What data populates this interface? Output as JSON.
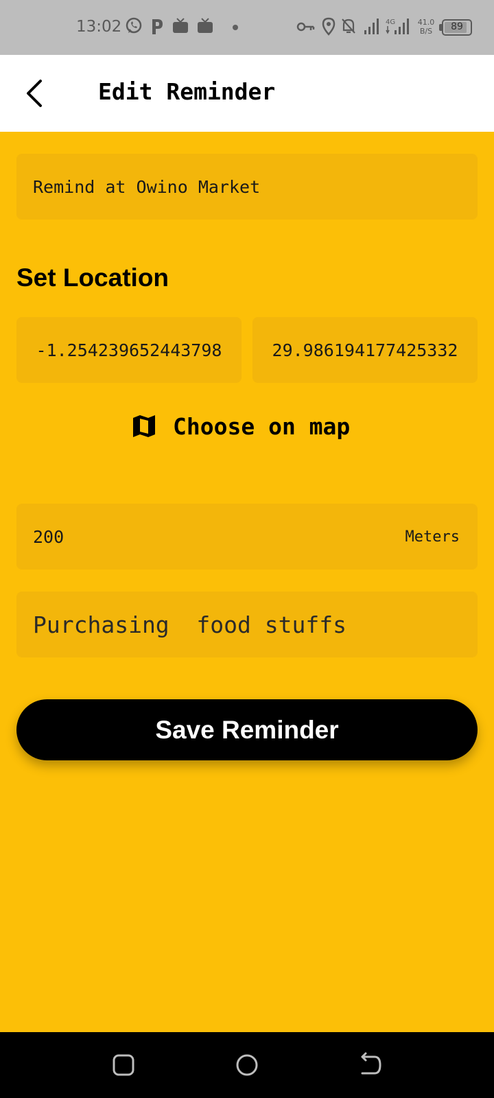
{
  "status_bar": {
    "time": "13:02",
    "net_speed_value": "41.0",
    "net_speed_unit": "B/S",
    "battery_level": "89",
    "icons": [
      "whatsapp-icon",
      "parking-app-icon",
      "tv-icon",
      "tv-icon",
      "notification-dot",
      "vpn-key-icon",
      "location-pin-icon",
      "bell-off-icon",
      "signal-icon",
      "4g-signal-icon",
      "battery-icon"
    ],
    "network_type": "4G"
  },
  "app_bar": {
    "title": "Edit Reminder",
    "back_icon": "arrow-back-icon"
  },
  "form": {
    "title_value": "Remind at Owino Market",
    "section_label": "Set Location",
    "latitude": "-1.254239652443798",
    "longitude": "29.986194177425332",
    "choose_map_label": "Choose on map",
    "choose_map_icon": "map-icon",
    "radius_value": "200",
    "radius_unit": "Meters",
    "note_value": "Purchasing  food stuffs",
    "save_label": "Save Reminder"
  },
  "colors": {
    "background": "#FCBF07",
    "field_background": "#F3B60B",
    "button": "#000000",
    "button_text": "#FFFFFF"
  },
  "nav_bar": {
    "buttons": [
      "recent-apps-icon",
      "home-icon",
      "back-icon"
    ]
  }
}
